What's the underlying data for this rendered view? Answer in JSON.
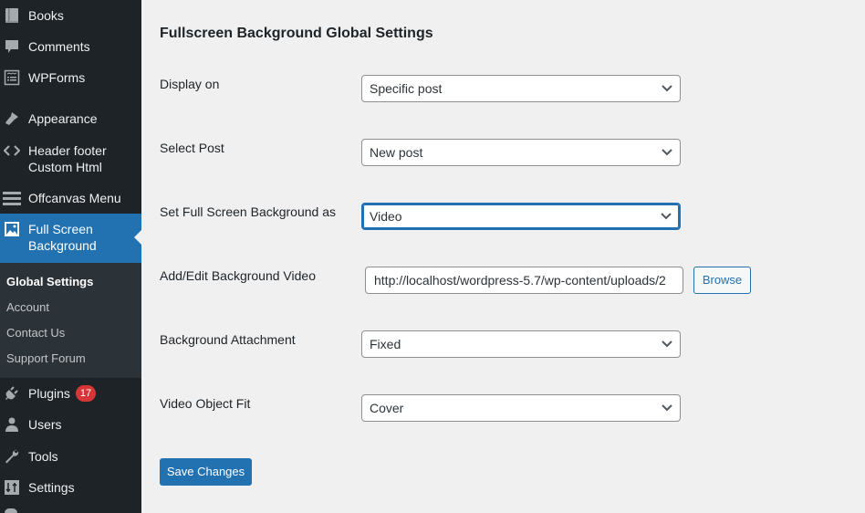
{
  "sidebar": {
    "items": [
      {
        "label": "Books",
        "icon": "book-icon"
      },
      {
        "label": "Comments",
        "icon": "comment-icon"
      },
      {
        "label": "WPForms",
        "icon": "form-icon"
      },
      {
        "label": "Appearance",
        "icon": "paintbrush-icon"
      },
      {
        "label": "Header footer",
        "label2": "Custom Html",
        "icon": "code-icon"
      },
      {
        "label": "Offcanvas Menu",
        "icon": "menu-icon"
      },
      {
        "label": "Full Screen",
        "label2": "Background",
        "icon": "image-icon",
        "active": true
      },
      {
        "label": "Plugins",
        "icon": "plugin-icon",
        "badge": "17"
      },
      {
        "label": "Users",
        "icon": "user-icon"
      },
      {
        "label": "Tools",
        "icon": "wrench-icon"
      },
      {
        "label": "Settings",
        "icon": "sliders-icon"
      }
    ],
    "submenu": [
      {
        "label": "Global Settings",
        "current": true
      },
      {
        "label": "Account"
      },
      {
        "label": "Contact Us"
      },
      {
        "label": "Support Forum"
      }
    ]
  },
  "main": {
    "title": "Fullscreen Background Global Settings",
    "fields": {
      "display_on": {
        "label": "Display on",
        "value": "Specific post"
      },
      "select_post": {
        "label": "Select Post",
        "value": "New post"
      },
      "background_as": {
        "label": "Set Full Screen Background as",
        "value": "Video"
      },
      "background_video": {
        "label": "Add/Edit Background Video",
        "value": "http://localhost/wordpress-5.7/wp-content/uploads/2",
        "browse_label": "Browse"
      },
      "attachment": {
        "label": "Background Attachment",
        "value": "Fixed"
      },
      "object_fit": {
        "label": "Video Object Fit",
        "value": "Cover"
      }
    },
    "save_label": "Save Changes"
  },
  "colors": {
    "sidebar_bg": "#1d2327",
    "submenu_bg": "#2c3338",
    "accent": "#2271b1",
    "badge": "#d63638",
    "page_bg": "#f0f0f1"
  }
}
